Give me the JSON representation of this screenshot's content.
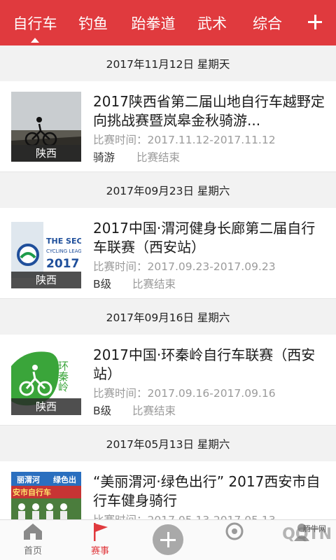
{
  "tabs": [
    {
      "label": "自行车",
      "active": true
    },
    {
      "label": "钓鱼"
    },
    {
      "label": "跆拳道"
    },
    {
      "label": "武术"
    },
    {
      "label": "综合"
    }
  ],
  "groups": [
    {
      "date": "2017年11月12日  星期天",
      "event": {
        "title": "2017陕西省第二届山地自行车越野定向挑战赛暨岚皋金秋骑游...",
        "time": "比赛时间：2017.11.12-2017.11.12",
        "tag": "骑游",
        "status": "比赛结束",
        "region": "陕西"
      }
    },
    {
      "date": "2017年09月23日  星期六",
      "event": {
        "title": "2017中国·渭河健身长廊第二届自行车联赛（西安站）",
        "time": "比赛时间：2017.09.23-2017.09.23",
        "tag": "B级",
        "status": "比赛结束",
        "region": "陕西",
        "img_text": [
          "THE SECO",
          "CYCLING LEAG",
          "2017"
        ]
      }
    },
    {
      "date": "2017年09月16日  星期六",
      "event": {
        "title": "2017中国·环秦岭自行车联赛（西安站）",
        "time": "比赛时间：2017.09.16-2017.09.16",
        "tag": "B级",
        "status": "比赛结束",
        "region": "陕西",
        "img_text": "环秦岭"
      }
    },
    {
      "date": "2017年05月13日  星期六",
      "event": {
        "title": "“美丽渭河·绿色出行” 2017西安市自行车健身骑行",
        "time": "比赛时间：2017.05.13-2017.05.13",
        "img_text": [
          "丽渭河",
          "绿色出",
          "安市自行车"
        ]
      }
    }
  ],
  "bottom_nav": {
    "home": "首页",
    "events": "赛事",
    "watermark": "QQTN",
    "watermark_small": "腾牛网"
  },
  "colors": {
    "accent": "#e03a3e",
    "muted": "#9b9b9b"
  }
}
